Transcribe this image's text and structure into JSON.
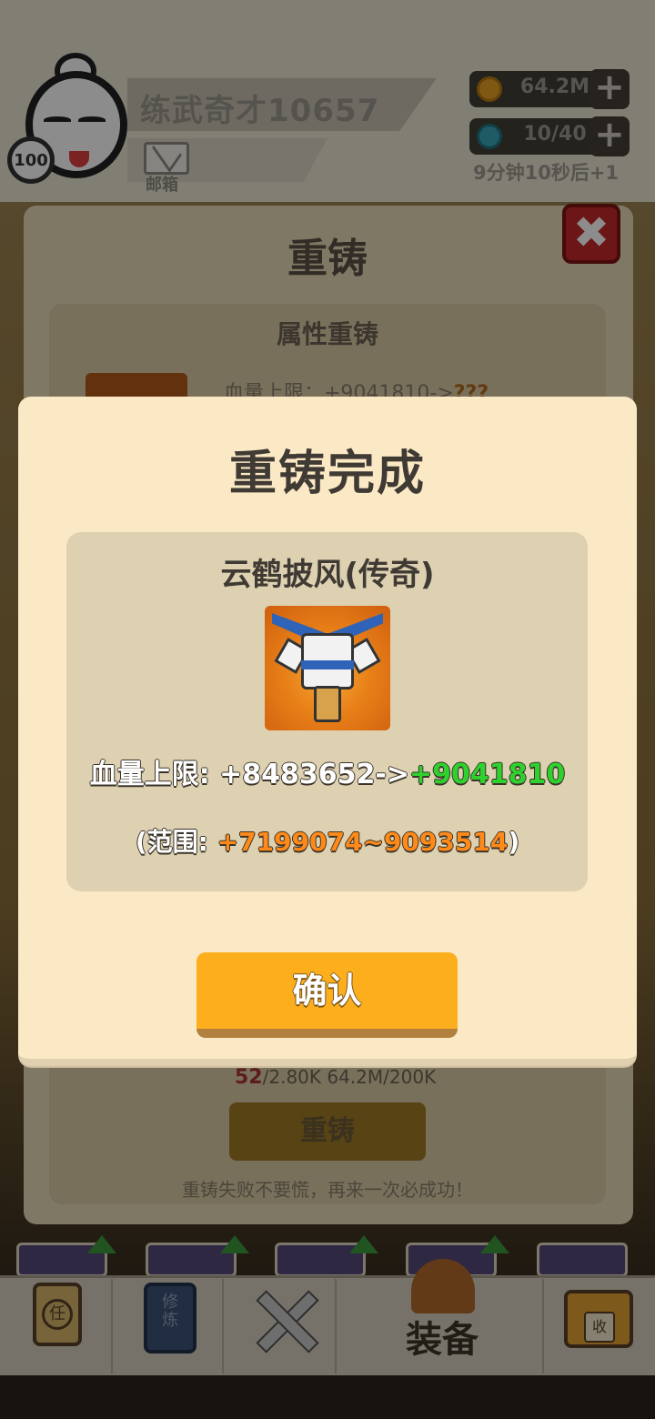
{
  "player": {
    "name": "练武奇才10657",
    "level": "100",
    "mail_label": "邮箱"
  },
  "resources": {
    "gold": "64.2M",
    "gold_icon": "gold-coin-icon",
    "energy": "10/40",
    "energy_icon": "gem-icon",
    "plus": "+",
    "regen_text": "9分钟10秒后+1"
  },
  "background_panel": {
    "title": "重铸",
    "close_glyph": "✖",
    "section_title": "属性重铸",
    "stat_label": "血量上限：+9041810->",
    "stat_unknown": "???",
    "cost_owned": "52",
    "cost_text": "/2.80K  64.2M/200K",
    "button": "重铸",
    "tip": "重铸失败不要慌，再来一次必成功！"
  },
  "dialog": {
    "title": "重铸完成",
    "item_name": "云鹤披风(传奇)",
    "stat_prefix": "血量上限: +8483652->",
    "stat_new": "+9041810",
    "range_prefix": "(范围: ",
    "range_value": "+7199074~9093514",
    "range_suffix": ")",
    "confirm": "确认"
  },
  "bottom_nav": {
    "task_glyph": "任",
    "cultivate_glyph": "修炼",
    "battle_icon": "crossed-swords-icon",
    "equipment_label": "装备",
    "collect_glyph": "收"
  },
  "colors": {
    "accent_button": "#fcae1c",
    "stat_new": "#2fd12f",
    "range_value": "#ff8a1a",
    "dialog_bg": "#fbe8c5"
  }
}
